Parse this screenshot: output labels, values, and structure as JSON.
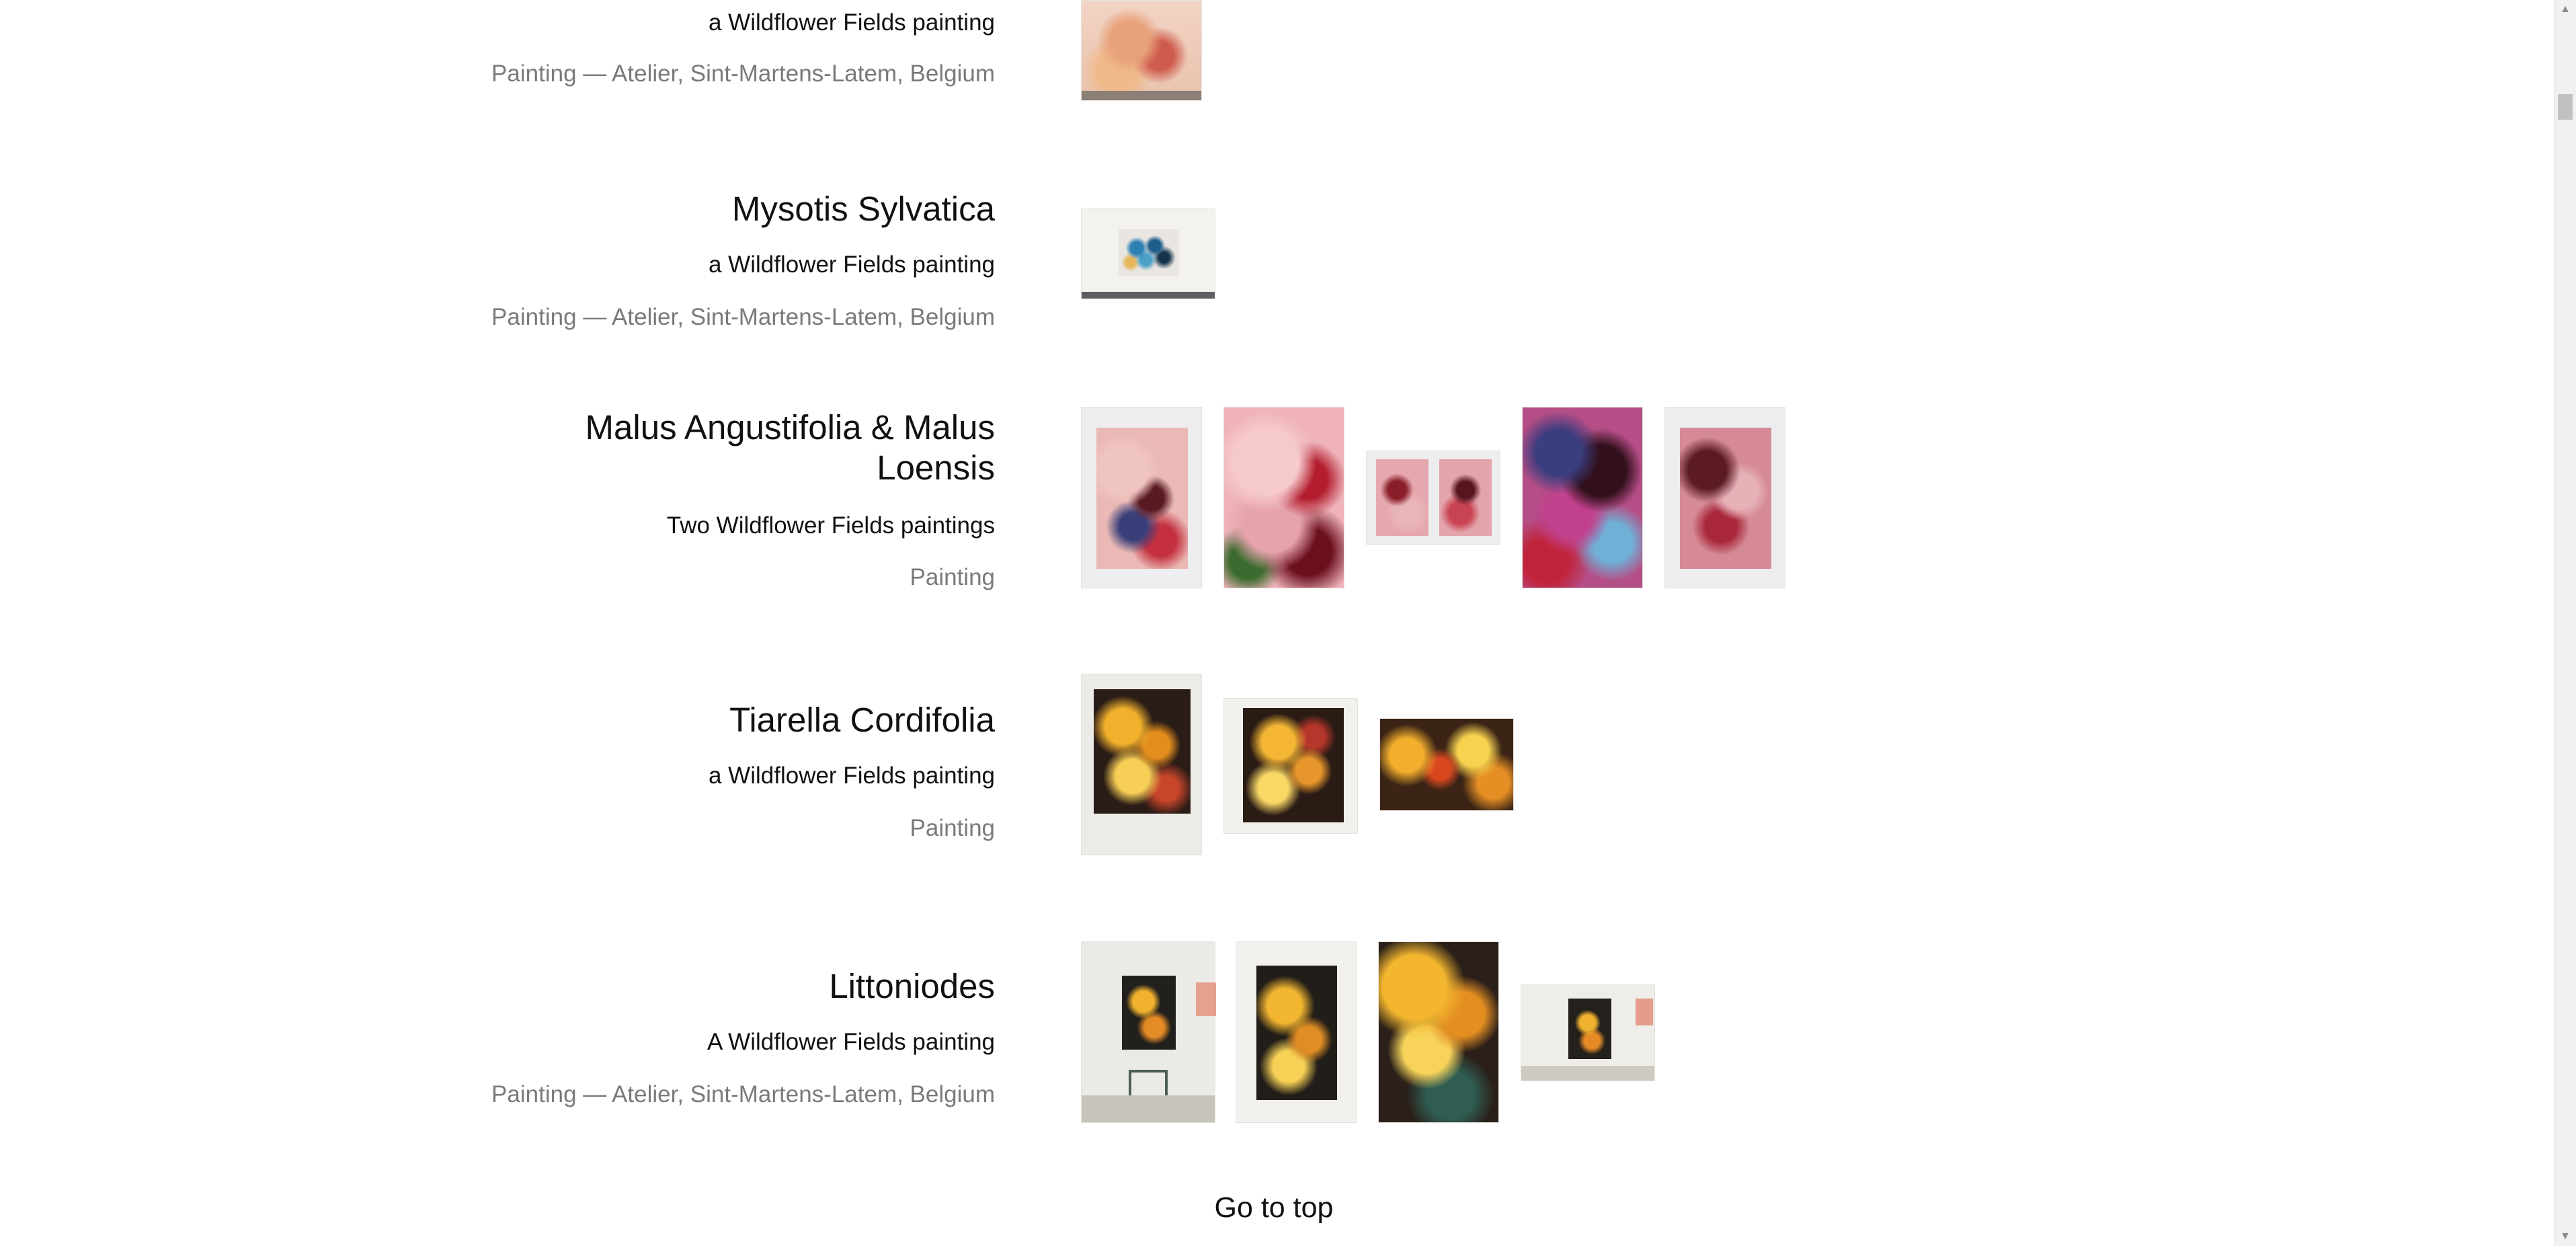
{
  "projects": [
    {
      "title": "",
      "subtitle": "a Wildflower Fields painting",
      "meta": "Painting — Atelier, Sint-Martens-Latem, Belgium"
    },
    {
      "title": "Mysotis Sylvatica",
      "subtitle": "a Wildflower Fields painting",
      "meta": "Painting — Atelier, Sint-Martens-Latem, Belgium"
    },
    {
      "title_line1": "Malus Angustifolia & Malus",
      "title_line2": "Loensis",
      "subtitle": "Two Wildflower Fields paintings",
      "meta": "Painting"
    },
    {
      "title": "Tiarella Cordifolia",
      "subtitle": "a Wildflower Fields painting",
      "meta": "Painting"
    },
    {
      "title": "Littoniodes",
      "subtitle": "A Wildflower Fields painting",
      "meta": "Painting — Atelier, Sint-Martens-Latem, Belgium"
    }
  ],
  "go_to_top": "Go to top",
  "colors": {
    "text": "#111111",
    "muted": "#7a7a7a",
    "background": "#ffffff"
  },
  "icons": {
    "scroll_up": "triangle-up",
    "scroll_down": "triangle-down"
  }
}
